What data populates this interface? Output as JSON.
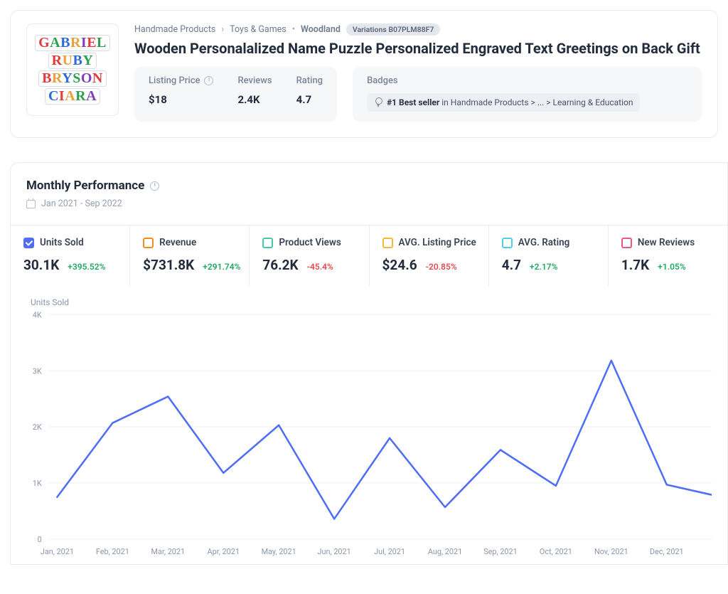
{
  "breadcrumb": {
    "cat1": "Handmade Products",
    "cat2": "Toys & Games",
    "brand": "Woodland",
    "variations_label": "Variations B07PLM88F7"
  },
  "product": {
    "title": "Wooden Personalalized Name Puzzle Personalized Engraved Text Greetings on Back Gift for Baby Boy",
    "image_names": [
      "GABRIEL",
      "RUBY",
      "BRYSON",
      "CIARA"
    ]
  },
  "stats": {
    "listing_price_label": "Listing Price",
    "listing_price": "$18",
    "reviews_label": "Reviews",
    "reviews": "2.4K",
    "rating_label": "Rating",
    "rating": "4.7",
    "badges_label": "Badges",
    "badge_rank": "#1 Best seller",
    "badge_in": " in Handmade Products > ... > Learning & Education"
  },
  "perf": {
    "title": "Monthly Performance",
    "range": "Jan 2021 - Sep 2022",
    "chart_label": "Units Sold"
  },
  "metrics": [
    {
      "key": "units",
      "label": "Units Sold",
      "value": "30.1K",
      "delta": "+395.52%",
      "dir": "pos",
      "color": "#4f6ef7",
      "checked": true
    },
    {
      "key": "rev",
      "label": "Revenue",
      "value": "$731.8K",
      "delta": "+291.74%",
      "dir": "pos",
      "color": "#f58a1f",
      "checked": false
    },
    {
      "key": "views",
      "label": "Product Views",
      "value": "76.2K",
      "delta": "-45.4%",
      "dir": "neg",
      "color": "#47c9a7",
      "checked": false
    },
    {
      "key": "price",
      "label": "AVG. Listing Price",
      "value": "$24.6",
      "delta": "-20.85%",
      "dir": "neg",
      "color": "#f5b83d",
      "checked": false
    },
    {
      "key": "rating",
      "label": "AVG. Rating",
      "value": "4.7",
      "delta": "+2.17%",
      "dir": "pos",
      "color": "#4fd0e0",
      "checked": false
    },
    {
      "key": "newrev",
      "label": "New Reviews",
      "value": "1.7K",
      "delta": "+1.05%",
      "dir": "pos",
      "color": "#e85a7a",
      "checked": false
    }
  ],
  "chart_data": {
    "type": "line",
    "title": "Units Sold",
    "xlabel": "",
    "ylabel": "",
    "ylim": [
      0,
      4000
    ],
    "y_ticks": [
      0,
      1000,
      2000,
      3000,
      4000
    ],
    "y_tick_labels": [
      "0",
      "1K",
      "2K",
      "3K",
      "4K"
    ],
    "categories": [
      "Jan, 2021",
      "Feb, 2021",
      "Mar, 2021",
      "Apr, 2021",
      "May, 2021",
      "Jun, 2021",
      "Jul, 2021",
      "Aug, 2021",
      "Sep, 2021",
      "Oct, 2021",
      "Nov, 2021",
      "Dec, 2021"
    ],
    "series": [
      {
        "name": "Units Sold",
        "values": [
          750,
          2070,
          2540,
          1180,
          2030,
          360,
          1800,
          570,
          1590,
          950,
          3180,
          970
        ]
      }
    ],
    "trailing_value": 790
  }
}
